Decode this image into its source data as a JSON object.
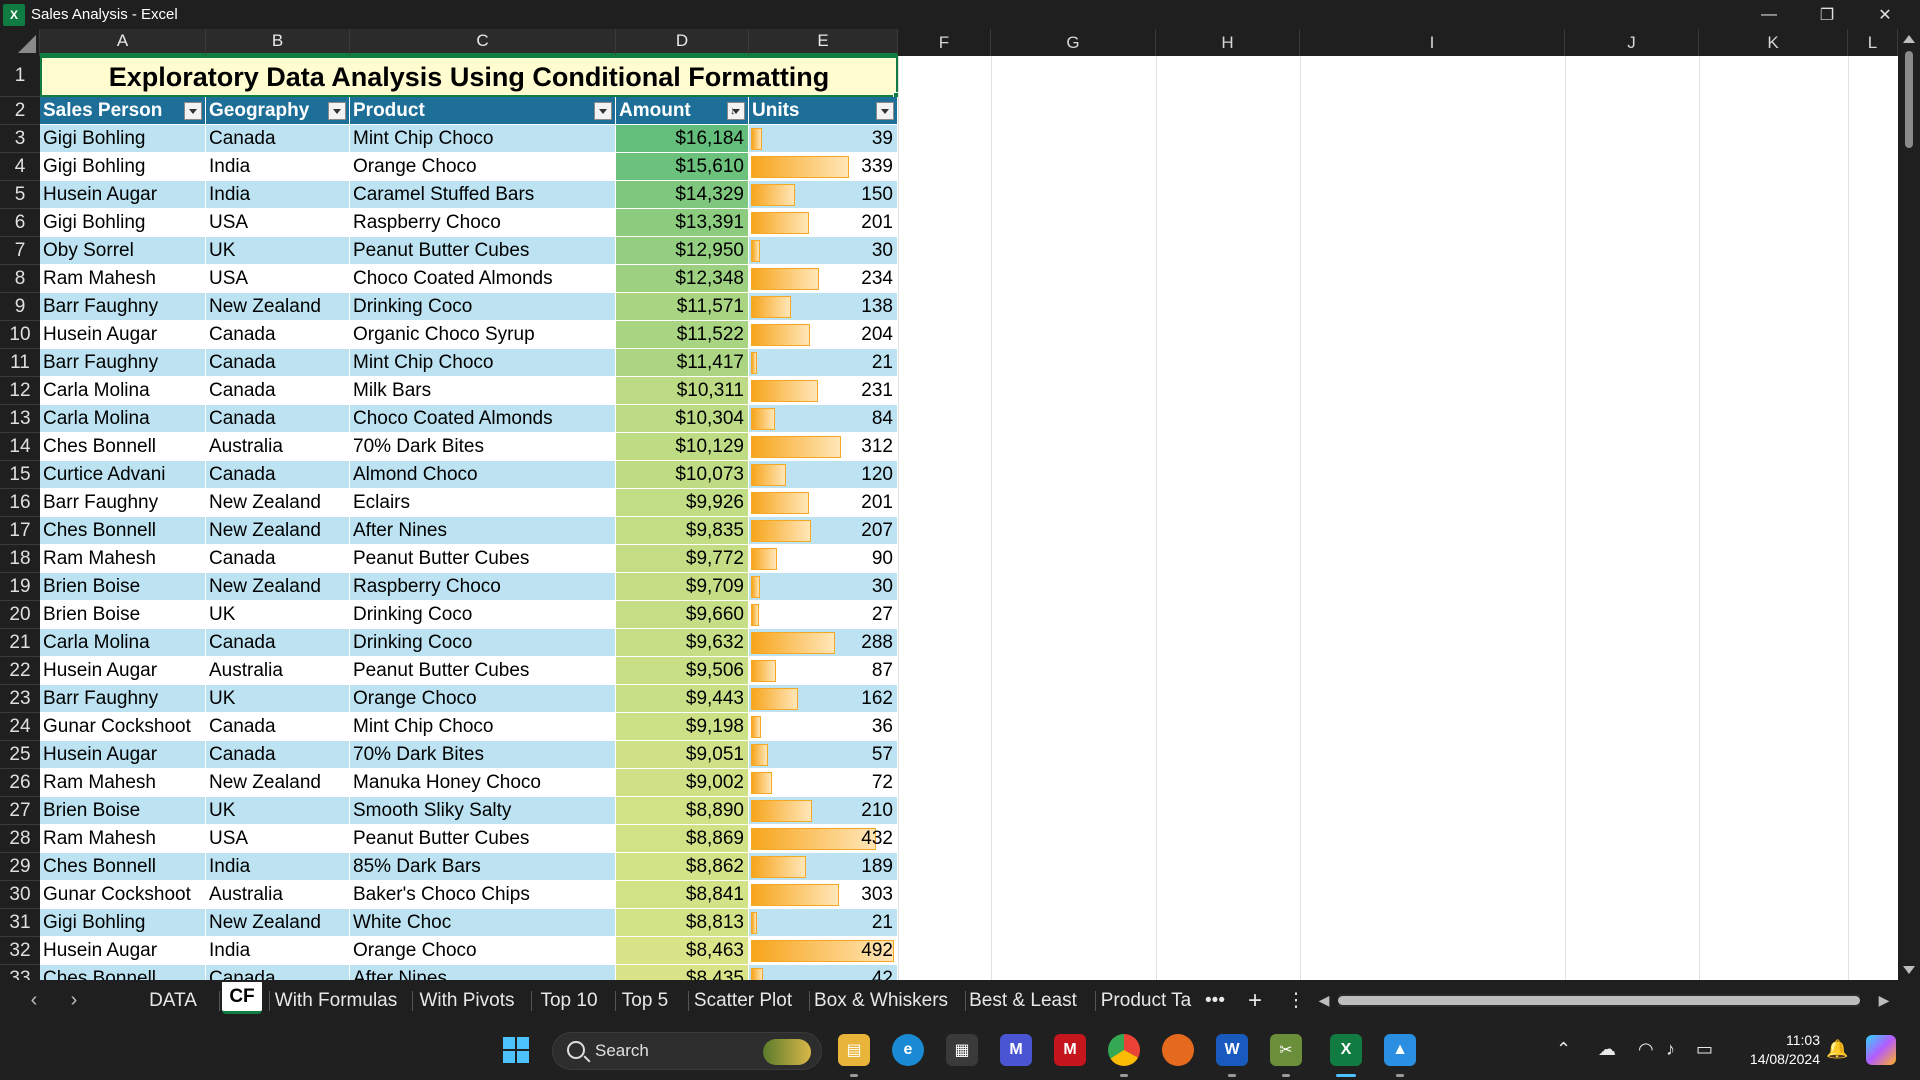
{
  "window": {
    "title": "Sales Analysis - Excel",
    "app_icon": "excel-logo-icon"
  },
  "columns": [
    "A",
    "B",
    "C",
    "D",
    "E",
    "F",
    "G",
    "H",
    "I",
    "J",
    "K",
    "L"
  ],
  "sheet_title": "Exploratory Data Analysis Using Conditional Formatting",
  "table": {
    "headers": [
      "Sales Person",
      "Geography",
      "Product",
      "Amount",
      "Units"
    ],
    "rows": [
      {
        "row": "3",
        "person": "Gigi Bohling",
        "geo": "Canada",
        "product": "Mint Chip Choco",
        "amount": "$16,184",
        "units": "39",
        "units_value": 39
      },
      {
        "row": "4",
        "person": "Gigi Bohling",
        "geo": "India",
        "product": "Orange Choco",
        "amount": "$15,610",
        "units": "339",
        "units_value": 339
      },
      {
        "row": "5",
        "person": "Husein Augar",
        "geo": "India",
        "product": "Caramel Stuffed Bars",
        "amount": "$14,329",
        "units": "150",
        "units_value": 150
      },
      {
        "row": "6",
        "person": "Gigi Bohling",
        "geo": "USA",
        "product": "Raspberry Choco",
        "amount": "$13,391",
        "units": "201",
        "units_value": 201
      },
      {
        "row": "7",
        "person": "Oby Sorrel",
        "geo": "UK",
        "product": "Peanut Butter Cubes",
        "amount": "$12,950",
        "units": "30",
        "units_value": 30
      },
      {
        "row": "8",
        "person": "Ram Mahesh",
        "geo": "USA",
        "product": "Choco Coated Almonds",
        "amount": "$12,348",
        "units": "234",
        "units_value": 234
      },
      {
        "row": "9",
        "person": "Barr Faughny",
        "geo": "New Zealand",
        "product": "Drinking Coco",
        "amount": "$11,571",
        "units": "138",
        "units_value": 138
      },
      {
        "row": "10",
        "person": "Husein Augar",
        "geo": "Canada",
        "product": "Organic Choco Syrup",
        "amount": "$11,522",
        "units": "204",
        "units_value": 204
      },
      {
        "row": "11",
        "person": "Barr Faughny",
        "geo": "Canada",
        "product": "Mint Chip Choco",
        "amount": "$11,417",
        "units": "21",
        "units_value": 21
      },
      {
        "row": "12",
        "person": "Carla Molina",
        "geo": "Canada",
        "product": "Milk Bars",
        "amount": "$10,311",
        "units": "231",
        "units_value": 231
      },
      {
        "row": "13",
        "person": "Carla Molina",
        "geo": "Canada",
        "product": "Choco Coated Almonds",
        "amount": "$10,304",
        "units": "84",
        "units_value": 84
      },
      {
        "row": "14",
        "person": "Ches Bonnell",
        "geo": "Australia",
        "product": "70% Dark Bites",
        "amount": "$10,129",
        "units": "312",
        "units_value": 312
      },
      {
        "row": "15",
        "person": "Curtice Advani",
        "geo": "Canada",
        "product": "Almond Choco",
        "amount": "$10,073",
        "units": "120",
        "units_value": 120
      },
      {
        "row": "16",
        "person": "Barr Faughny",
        "geo": "New Zealand",
        "product": "Eclairs",
        "amount": "$9,926",
        "units": "201",
        "units_value": 201
      },
      {
        "row": "17",
        "person": "Ches Bonnell",
        "geo": "New Zealand",
        "product": "After Nines",
        "amount": "$9,835",
        "units": "207",
        "units_value": 207
      },
      {
        "row": "18",
        "person": "Ram Mahesh",
        "geo": "Canada",
        "product": "Peanut Butter Cubes",
        "amount": "$9,772",
        "units": "90",
        "units_value": 90
      },
      {
        "row": "19",
        "person": "Brien Boise",
        "geo": "New Zealand",
        "product": "Raspberry Choco",
        "amount": "$9,709",
        "units": "30",
        "units_value": 30
      },
      {
        "row": "20",
        "person": "Brien Boise",
        "geo": "UK",
        "product": "Drinking Coco",
        "amount": "$9,660",
        "units": "27",
        "units_value": 27
      },
      {
        "row": "21",
        "person": "Carla Molina",
        "geo": "Canada",
        "product": "Drinking Coco",
        "amount": "$9,632",
        "units": "288",
        "units_value": 288
      },
      {
        "row": "22",
        "person": "Husein Augar",
        "geo": "Australia",
        "product": "Peanut Butter Cubes",
        "amount": "$9,506",
        "units": "87",
        "units_value": 87
      },
      {
        "row": "23",
        "person": "Barr Faughny",
        "geo": "UK",
        "product": "Orange Choco",
        "amount": "$9,443",
        "units": "162",
        "units_value": 162
      },
      {
        "row": "24",
        "person": "Gunar Cockshoot",
        "geo": "Canada",
        "product": "Mint Chip Choco",
        "amount": "$9,198",
        "units": "36",
        "units_value": 36
      },
      {
        "row": "25",
        "person": "Husein Augar",
        "geo": "Canada",
        "product": "70% Dark Bites",
        "amount": "$9,051",
        "units": "57",
        "units_value": 57
      },
      {
        "row": "26",
        "person": "Ram Mahesh",
        "geo": "New Zealand",
        "product": "Manuka Honey Choco",
        "amount": "$9,002",
        "units": "72",
        "units_value": 72
      },
      {
        "row": "27",
        "person": "Brien Boise",
        "geo": "UK",
        "product": "Smooth Sliky Salty",
        "amount": "$8,890",
        "units": "210",
        "units_value": 210
      },
      {
        "row": "28",
        "person": "Ram Mahesh",
        "geo": "USA",
        "product": "Peanut Butter Cubes",
        "amount": "$8,869",
        "units": "432",
        "units_value": 432
      },
      {
        "row": "29",
        "person": "Ches Bonnell",
        "geo": "India",
        "product": "85% Dark Bars",
        "amount": "$8,862",
        "units": "189",
        "units_value": 189
      },
      {
        "row": "30",
        "person": "Gunar Cockshoot",
        "geo": "Australia",
        "product": "Baker's Choco Chips",
        "amount": "$8,841",
        "units": "303",
        "units_value": 303
      },
      {
        "row": "31",
        "person": "Gigi Bohling",
        "geo": "New Zealand",
        "product": "White Choc",
        "amount": "$8,813",
        "units": "21",
        "units_value": 21
      },
      {
        "row": "32",
        "person": "Husein Augar",
        "geo": "India",
        "product": "Orange Choco",
        "amount": "$8,463",
        "units": "492",
        "units_value": 492
      },
      {
        "row": "33",
        "person": "Ches Bonnell",
        "geo": "Canada",
        "product": "After Nines",
        "amount": "$8,435",
        "units": "42",
        "units_value": 42
      }
    ]
  },
  "units_bar_max": 500,
  "amount_color_scale": {
    "high": "#63be7b",
    "low": "#d8e487"
  },
  "tabs": {
    "items": [
      "DATA",
      "CF",
      "With Formulas",
      "With Pivots",
      "Top 10",
      "Top 5",
      "Scatter Plot",
      "Box & Whiskers",
      "Best & Least",
      "Product Ta"
    ],
    "active": "CF",
    "more_label": "•••",
    "add_label": "+",
    "menu_label": "⋮"
  },
  "taskbar": {
    "search_placeholder": "Search",
    "time": "11:03",
    "date": "14/08/2024"
  }
}
